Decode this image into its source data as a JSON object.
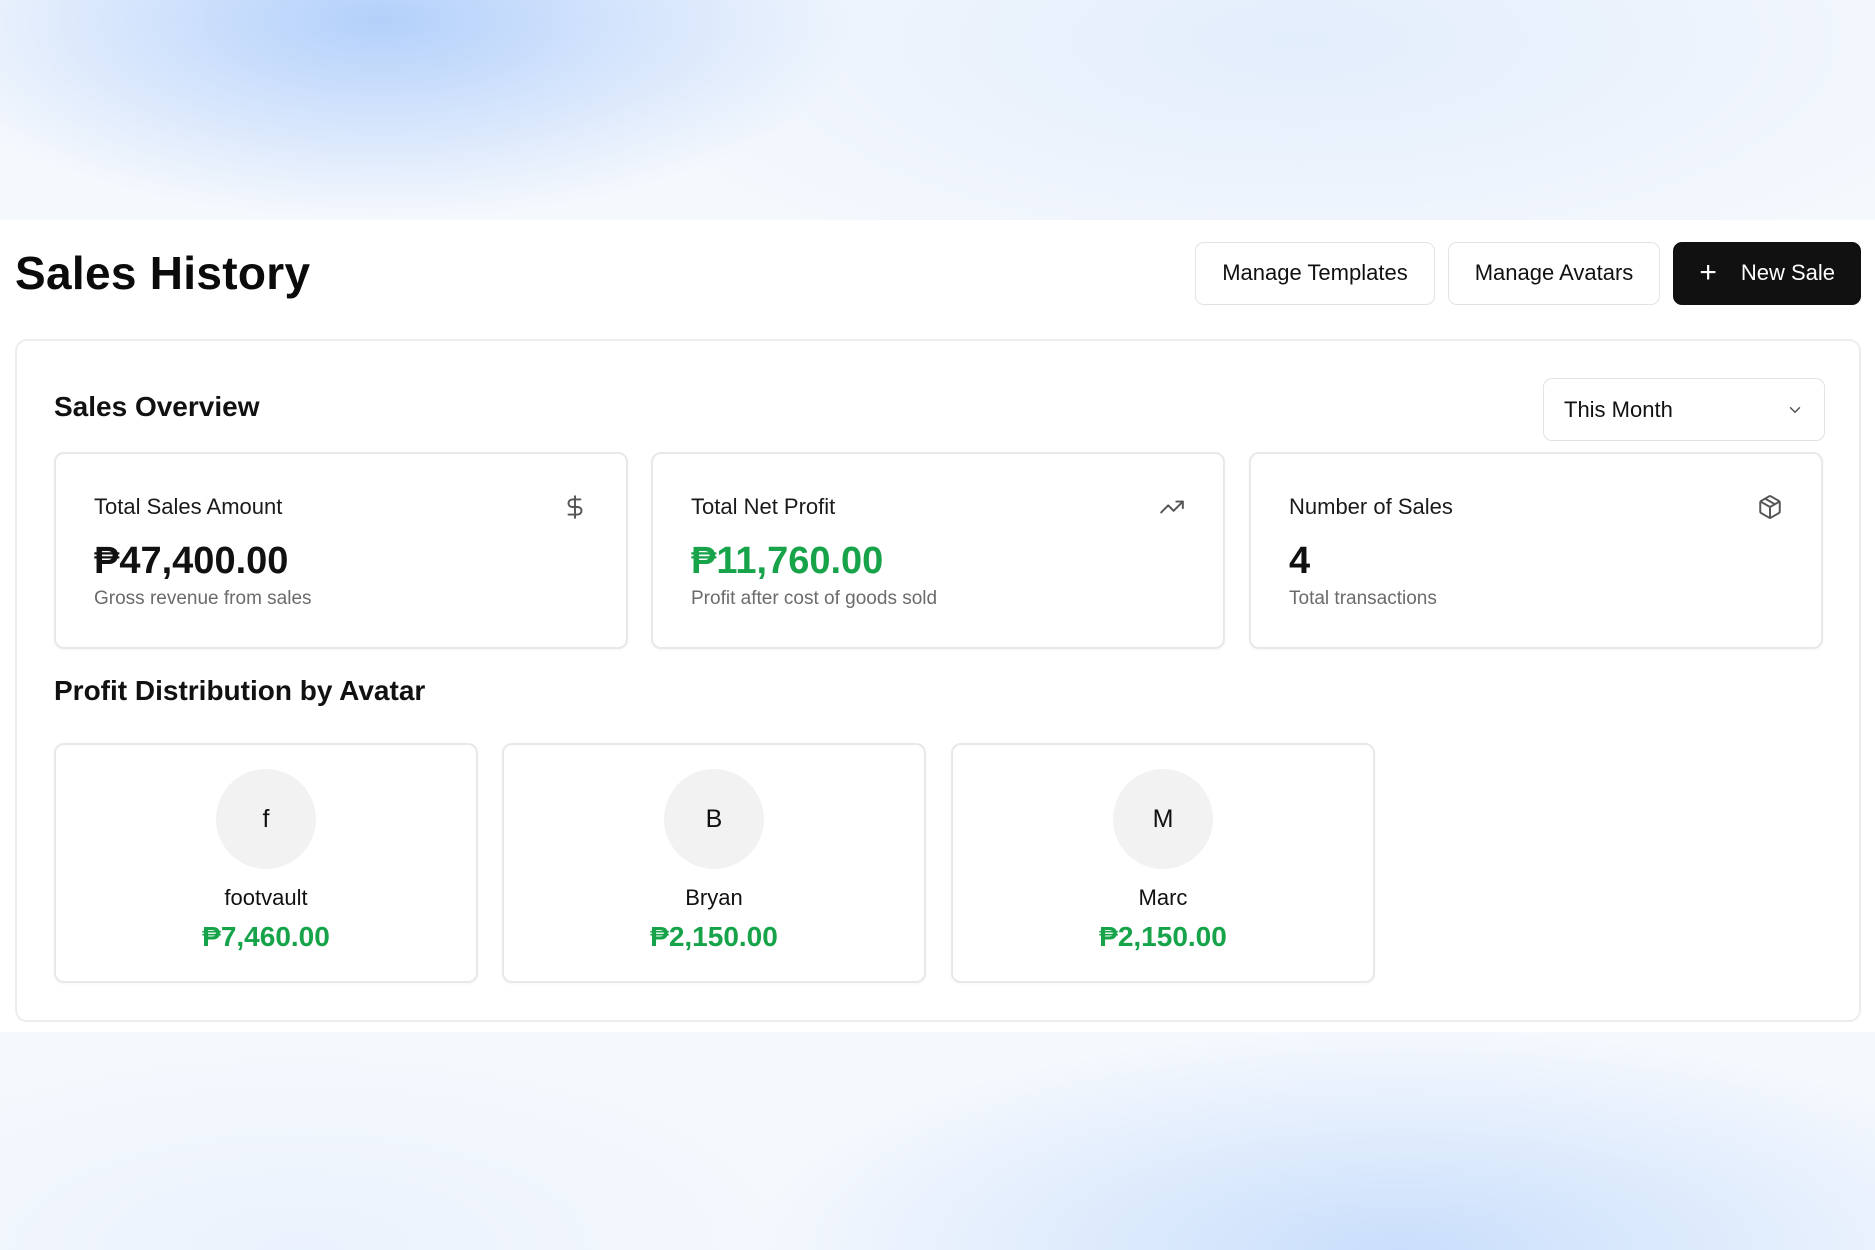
{
  "header": {
    "title": "Sales History",
    "manage_templates_label": "Manage Templates",
    "manage_avatars_label": "Manage Avatars",
    "new_sale_label": "New Sale",
    "new_sale_icon": "plus-icon"
  },
  "overview": {
    "title": "Sales Overview",
    "period": {
      "selected": "This Month",
      "icon": "chevron-down-icon"
    },
    "cards": [
      {
        "label": "Total Sales Amount",
        "value": "₱47,400.00",
        "subtitle": "Gross revenue from sales",
        "icon": "dollar-icon",
        "value_color": "#111111"
      },
      {
        "label": "Total Net Profit",
        "value": "₱11,760.00",
        "subtitle": "Profit after cost of goods sold",
        "icon": "trending-up-icon",
        "value_color": "#16a34a"
      },
      {
        "label": "Number of Sales",
        "value": "4",
        "subtitle": "Total transactions",
        "icon": "package-icon",
        "value_color": "#111111"
      }
    ]
  },
  "distribution": {
    "title": "Profit Distribution by Avatar",
    "avatars": [
      {
        "initial": "f",
        "name": "footvault",
        "profit": "₱7,460.00"
      },
      {
        "initial": "B",
        "name": "Bryan",
        "profit": "₱2,150.00"
      },
      {
        "initial": "M",
        "name": "Marc",
        "profit": "₱2,150.00"
      }
    ]
  },
  "colors": {
    "accent": "#111111",
    "profit": "#16a34a",
    "border": "#e8e8e8"
  }
}
